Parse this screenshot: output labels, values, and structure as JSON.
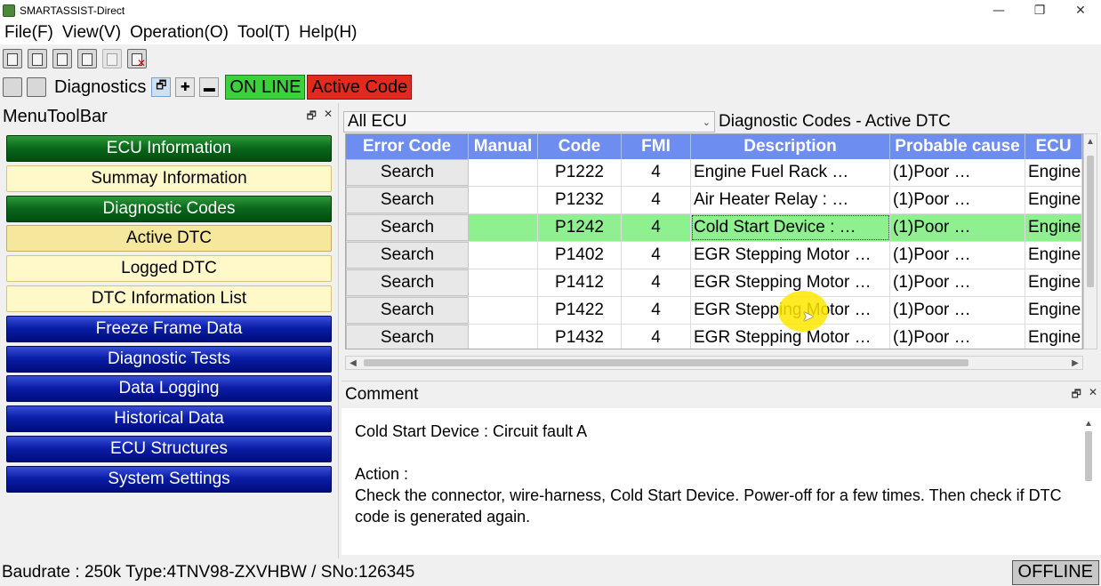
{
  "window": {
    "title": "SMARTASSIST-Direct",
    "minimize": "—",
    "restore": "❐",
    "close": "✕"
  },
  "menubar": {
    "file": "File(F)",
    "view": "View(V)",
    "operation": "Operation(O)",
    "tool": "Tool(T)",
    "help": "Help(H)"
  },
  "toolbar2": {
    "label": "Diagnostics",
    "online": "ON LINE",
    "active_code": "Active Code",
    "btn_window": "🗗",
    "btn_add": "✚",
    "btn_minus": "▬"
  },
  "left_panel": {
    "title": "MenuToolBar",
    "float": "🗗",
    "close": "✕",
    "items": [
      {
        "label": "ECU Information",
        "style": "green"
      },
      {
        "label": "Summay Information",
        "style": "yellow"
      },
      {
        "label": "Diagnostic Codes",
        "style": "green"
      },
      {
        "label": "Active DTC",
        "style": "yellow-sel"
      },
      {
        "label": "Logged DTC",
        "style": "yellow"
      },
      {
        "label": "DTC Information List",
        "style": "yellow"
      },
      {
        "label": "Freeze Frame Data",
        "style": "blue"
      },
      {
        "label": "Diagnostic Tests",
        "style": "blue"
      },
      {
        "label": "Data Logging",
        "style": "blue"
      },
      {
        "label": "Historical Data",
        "style": "blue"
      },
      {
        "label": "ECU Structures",
        "style": "blue"
      },
      {
        "label": "System Settings",
        "style": "blue"
      }
    ]
  },
  "dtc_panel": {
    "ecu_select": "All ECU",
    "title": "Diagnostic Codes - Active DTC",
    "columns": [
      "Error Code",
      "Manual",
      "Code",
      "FMI",
      "Description",
      "Probable cause",
      "ECU"
    ],
    "rows": [
      {
        "error": "Search",
        "manual": "",
        "code": "P1222",
        "fmi": "4",
        "desc": "Engine Fuel Rack …",
        "cause": "(1)Poor …",
        "ecu": "Engine"
      },
      {
        "error": "Search",
        "manual": "",
        "code": "P1232",
        "fmi": "4",
        "desc": "Air Heater Relay : …",
        "cause": "(1)Poor …",
        "ecu": "Engine"
      },
      {
        "error": "Search",
        "manual": "",
        "code": "P1242",
        "fmi": "4",
        "desc": "Cold Start Device : …",
        "cause": "(1)Poor …",
        "ecu": "Engine"
      },
      {
        "error": "Search",
        "manual": "",
        "code": "P1402",
        "fmi": "4",
        "desc": "EGR Stepping Motor …",
        "cause": "(1)Poor …",
        "ecu": "Engine"
      },
      {
        "error": "Search",
        "manual": "",
        "code": "P1412",
        "fmi": "4",
        "desc": "EGR Stepping Motor …",
        "cause": "(1)Poor …",
        "ecu": "Engine"
      },
      {
        "error": "Search",
        "manual": "",
        "code": "P1422",
        "fmi": "4",
        "desc": "EGR Stepping Motor …",
        "cause": "(1)Poor …",
        "ecu": "Engine"
      },
      {
        "error": "Search",
        "manual": "",
        "code": "P1432",
        "fmi": "4",
        "desc": "EGR Stepping Motor …",
        "cause": "(1)Poor …",
        "ecu": "Engine"
      }
    ],
    "selected_row": 2
  },
  "comment_panel": {
    "title": "Comment",
    "float": "🗗",
    "close": "✕",
    "line1": "Cold Start Device : Circuit fault A",
    "action_label": "Action :",
    "action_text": "Check the connector, wire-harness, Cold Start Device. Power-off for a few times. Then check if DTC code is generated again."
  },
  "statusbar": {
    "text": "Baudrate : 250k Type:4TNV98-ZXVHBW / SNo:126345",
    "offline": "OFFLINE"
  },
  "colors": {
    "online": "#3bd13b",
    "active_code": "#e22a1e",
    "grid_header": "#6d8ef0",
    "selected_row": "#8ef08e"
  }
}
